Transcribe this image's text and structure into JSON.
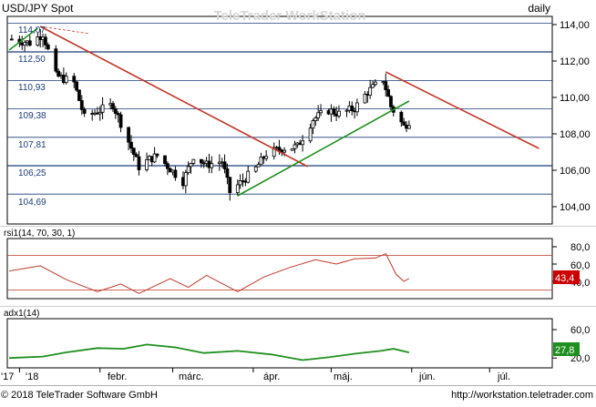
{
  "header": {
    "symbol": "USD/JPY Spot",
    "watermark": "TeleTrader WorkStation",
    "period": "daily"
  },
  "price_panel": {
    "right_axis_ticks": [
      "114,00",
      "112,00",
      "110,00",
      "108,00",
      "106,00",
      "104,00"
    ],
    "left_level_labels": [
      "114,07",
      "112,50",
      "110,93",
      "109,38",
      "107,81",
      "106,25",
      "104,69"
    ],
    "level_values": [
      114.07,
      112.5,
      110.93,
      109.38,
      107.81,
      106.25,
      104.69
    ]
  },
  "rsi_panel": {
    "label": "rsi1(14, 70, 30, 1)",
    "ticks": [
      "80,0",
      "60,0",
      "40,0"
    ],
    "current_value": "43,4",
    "levels": [
      70,
      30
    ]
  },
  "adx_panel": {
    "label": "adx1(14)",
    "ticks": [
      "60,0",
      "20,0"
    ],
    "current_value": "27,8"
  },
  "x_axis": {
    "labels": [
      "'17",
      "'18",
      "febr.",
      "márc.",
      "ápr.",
      "máj.",
      "jún.",
      "júl."
    ]
  },
  "footer": {
    "copyright": "© 2018 TeleTrader Software GmbH",
    "url": "http://workstation.teletrader.com"
  },
  "colors": {
    "candles": "#000000",
    "resistance_line": "#c0392b",
    "support_line": "#1f8f1f",
    "rsi_line": "#c0392b",
    "adx_line": "#1f8f1f",
    "level_line": "#1c3c78",
    "rsi_badge": "#cc0000",
    "adx_badge": "#1f8f1f"
  },
  "chart_data": [
    {
      "type": "candlestick",
      "title": "USD/JPY Spot",
      "period": "daily",
      "y_range": [
        103.4,
        114.8
      ],
      "y_ticks": [
        104,
        106,
        108,
        110,
        112,
        114
      ],
      "horizontal_levels": [
        114.07,
        112.5,
        110.93,
        109.38,
        107.81,
        106.25,
        104.69
      ],
      "price_path": [
        {
          "date": "2017-12-29",
          "close": 113.2
        },
        {
          "date": "2018-01-05",
          "close": 113.0
        },
        {
          "date": "2018-01-10",
          "close": 113.5
        },
        {
          "date": "2018-01-15",
          "close": 111.2
        },
        {
          "date": "2018-01-22",
          "close": 110.8
        },
        {
          "date": "2018-01-26",
          "close": 108.9
        },
        {
          "date": "2018-02-01",
          "close": 109.3
        },
        {
          "date": "2018-02-06",
          "close": 109.6
        },
        {
          "date": "2018-02-09",
          "close": 108.6
        },
        {
          "date": "2018-02-16",
          "close": 106.2
        },
        {
          "date": "2018-02-20",
          "close": 106.6
        },
        {
          "date": "2018-02-23",
          "close": 106.8
        },
        {
          "date": "2018-03-02",
          "close": 105.8
        },
        {
          "date": "2018-03-05",
          "close": 105.4
        },
        {
          "date": "2018-03-09",
          "close": 106.8
        },
        {
          "date": "2018-03-14",
          "close": 106.3
        },
        {
          "date": "2018-03-20",
          "close": 106.5
        },
        {
          "date": "2018-03-23",
          "close": 104.8
        },
        {
          "date": "2018-03-27",
          "close": 105.3
        },
        {
          "date": "2018-04-02",
          "close": 106.1
        },
        {
          "date": "2018-04-06",
          "close": 106.9
        },
        {
          "date": "2018-04-12",
          "close": 107.2
        },
        {
          "date": "2018-04-18",
          "close": 107.3
        },
        {
          "date": "2018-04-24",
          "close": 108.8
        },
        {
          "date": "2018-04-30",
          "close": 109.3
        },
        {
          "date": "2018-05-04",
          "close": 109.1
        },
        {
          "date": "2018-05-10",
          "close": 109.4
        },
        {
          "date": "2018-05-15",
          "close": 110.3
        },
        {
          "date": "2018-05-21",
          "close": 111.0
        },
        {
          "date": "2018-05-24",
          "close": 109.5
        },
        {
          "date": "2018-05-29",
          "close": 108.4
        },
        {
          "date": "2018-05-31",
          "close": 108.7
        }
      ],
      "trendlines": [
        {
          "name": "resistance",
          "from": {
            "date": "2018-01-09",
            "value": 113.9
          },
          "to": {
            "date": "2018-04-22",
            "value": 106.2
          }
        },
        {
          "name": "resistance",
          "from": {
            "date": "2018-05-22",
            "value": 111.4
          },
          "to": {
            "date": "2018-07-20",
            "value": 107.2
          }
        },
        {
          "name": "support",
          "from": {
            "date": "2018-03-26",
            "value": 104.6
          },
          "to": {
            "date": "2018-05-31",
            "value": 109.8
          }
        },
        {
          "name": "support",
          "from": {
            "date": "2017-12-28",
            "value": 112.6
          },
          "to": {
            "date": "2018-01-08",
            "value": 113.8
          }
        }
      ]
    },
    {
      "type": "line",
      "title": "rsi1(14, 70, 30, 1)",
      "y_ticks": [
        40,
        60,
        80
      ],
      "levels": [
        70,
        30
      ],
      "last": 43.4,
      "points": [
        {
          "date": "2017-12-28",
          "value": 52
        },
        {
          "date": "2018-01-09",
          "value": 58
        },
        {
          "date": "2018-01-19",
          "value": 42
        },
        {
          "date": "2018-01-31",
          "value": 28
        },
        {
          "date": "2018-02-09",
          "value": 37
        },
        {
          "date": "2018-02-16",
          "value": 26
        },
        {
          "date": "2018-02-28",
          "value": 43
        },
        {
          "date": "2018-03-07",
          "value": 33
        },
        {
          "date": "2018-03-14",
          "value": 47
        },
        {
          "date": "2018-03-26",
          "value": 28
        },
        {
          "date": "2018-04-05",
          "value": 45
        },
        {
          "date": "2018-04-15",
          "value": 56
        },
        {
          "date": "2018-04-25",
          "value": 65
        },
        {
          "date": "2018-05-03",
          "value": 60
        },
        {
          "date": "2018-05-10",
          "value": 66
        },
        {
          "date": "2018-05-18",
          "value": 67
        },
        {
          "date": "2018-05-22",
          "value": 72
        },
        {
          "date": "2018-05-26",
          "value": 48
        },
        {
          "date": "2018-05-29",
          "value": 40
        },
        {
          "date": "2018-05-31",
          "value": 43.4
        }
      ]
    },
    {
      "type": "line",
      "title": "adx1(14)",
      "y_ticks": [
        20,
        60
      ],
      "last": 27.8,
      "points": [
        {
          "date": "2017-12-28",
          "value": 20
        },
        {
          "date": "2018-01-10",
          "value": 22
        },
        {
          "date": "2018-01-19",
          "value": 28
        },
        {
          "date": "2018-01-31",
          "value": 34
        },
        {
          "date": "2018-02-10",
          "value": 33
        },
        {
          "date": "2018-02-19",
          "value": 39
        },
        {
          "date": "2018-03-02",
          "value": 35
        },
        {
          "date": "2018-03-13",
          "value": 27
        },
        {
          "date": "2018-03-26",
          "value": 30
        },
        {
          "date": "2018-04-08",
          "value": 25
        },
        {
          "date": "2018-04-20",
          "value": 17
        },
        {
          "date": "2018-04-30",
          "value": 21
        },
        {
          "date": "2018-05-10",
          "value": 26
        },
        {
          "date": "2018-05-20",
          "value": 30
        },
        {
          "date": "2018-05-25",
          "value": 33
        },
        {
          "date": "2018-05-31",
          "value": 27.8
        }
      ]
    }
  ]
}
